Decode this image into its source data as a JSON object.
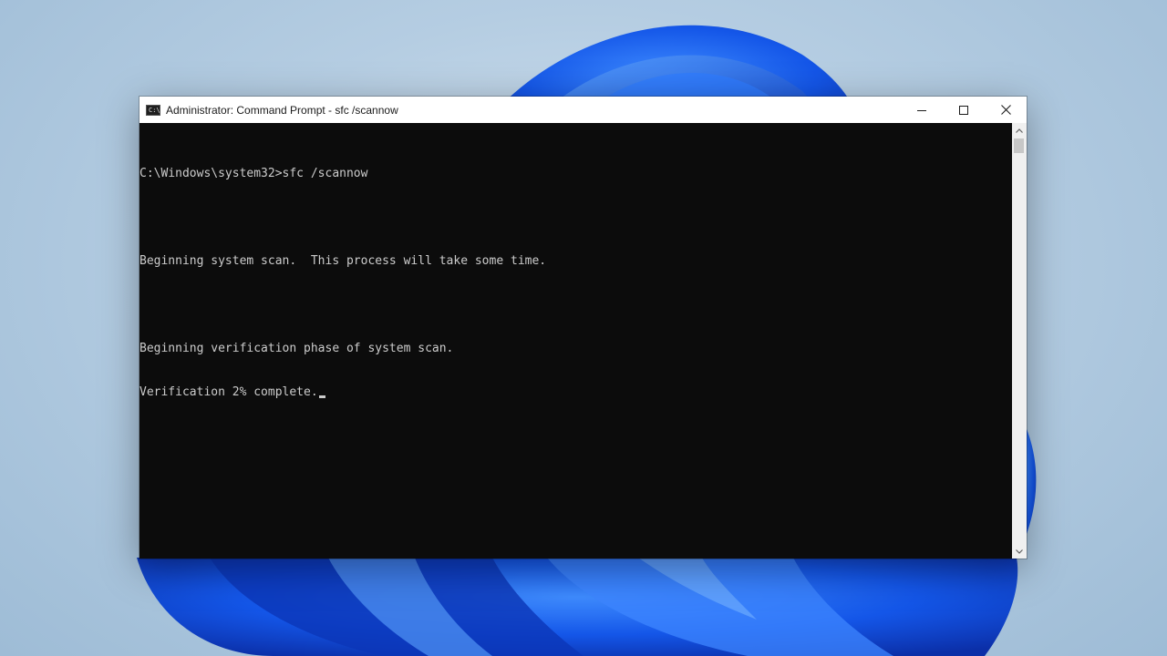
{
  "window": {
    "title": "Administrator: Command Prompt - sfc  /scannow",
    "app_icon_glyph": "C:\\"
  },
  "console": {
    "lines": [
      "C:\\Windows\\system32>sfc /scannow",
      "",
      "Beginning system scan.  This process will take some time.",
      "",
      "Beginning verification phase of system scan.",
      "Verification 2% complete."
    ]
  },
  "caption_buttons": {
    "minimize_icon": "minimize-icon",
    "maximize_icon": "maximize-icon",
    "close_icon": "close-icon"
  },
  "colors": {
    "console_bg": "#0c0c0c",
    "console_text": "#cccccc",
    "titlebar_bg": "#ffffff",
    "wallpaper_accent": "#1a5fe0"
  }
}
